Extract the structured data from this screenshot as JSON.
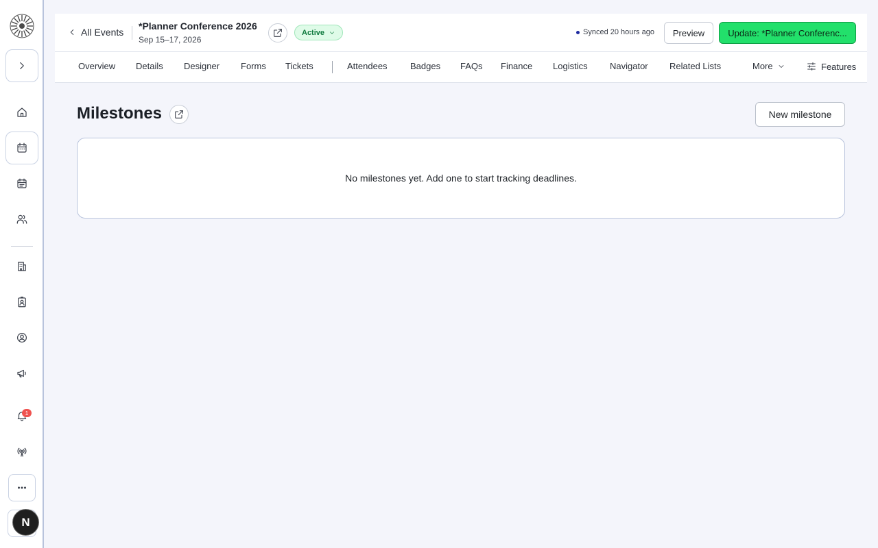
{
  "rail": {
    "logo_icon": "sunburst-logo-icon",
    "expand_icon": "chevron-right-icon",
    "items": [
      {
        "name": "home",
        "icon": "home-icon"
      },
      {
        "name": "events",
        "icon": "calendar-icon",
        "active": true
      },
      {
        "name": "schedule",
        "icon": "calendar-list-icon"
      },
      {
        "name": "people",
        "icon": "users-icon"
      },
      {
        "name": "venues",
        "icon": "building-icon"
      },
      {
        "name": "contacts",
        "icon": "contact-card-icon"
      },
      {
        "name": "account",
        "icon": "user-circle-icon"
      },
      {
        "name": "marketing",
        "icon": "megaphone-icon"
      },
      {
        "name": "notifications",
        "icon": "bell-icon"
      },
      {
        "name": "broadcast",
        "icon": "broadcast-icon"
      }
    ],
    "notification_count": "1",
    "more_icon": "ellipsis-icon",
    "avatar_initial": "N"
  },
  "header": {
    "back_label": "All Events",
    "event_title": "*Planner Conference 2026",
    "event_date": "Sep 15–17, 2026",
    "status": "Active",
    "sync_text": "Synced 20 hours ago",
    "preview_label": "Preview",
    "update_label": "Update: *Planner Conferenc..."
  },
  "tabs": {
    "items": [
      "Overview",
      "Details",
      "Designer",
      "Forms",
      "Tickets",
      "Attendees",
      "Badges",
      "FAQs",
      "Finance",
      "Logistics",
      "Navigator",
      "Related Lists"
    ],
    "more_label": "More",
    "features_label": "Features"
  },
  "main": {
    "title": "Milestones",
    "new_button": "New milestone",
    "empty_message": "No milestones yet. Add one to start tracking deadlines."
  },
  "colors": {
    "accent_green": "#22e06b",
    "status_bg": "#dffbe8",
    "badge_red": "#ef5350",
    "page_bg": "#f4f5fb"
  }
}
